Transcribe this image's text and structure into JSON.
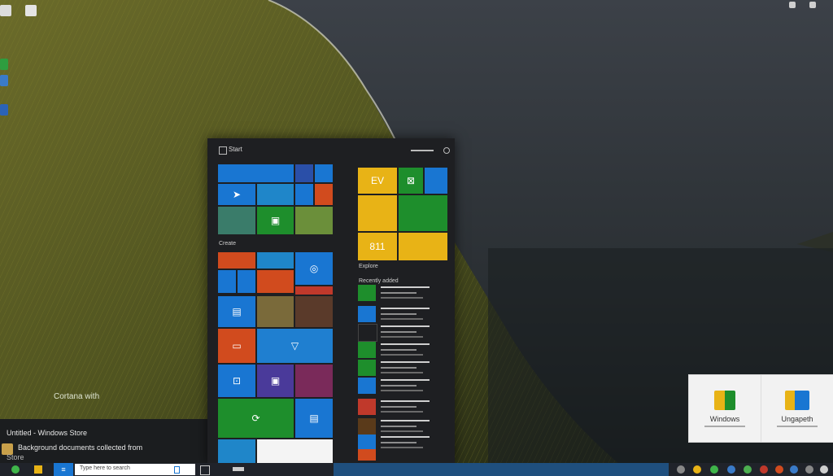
{
  "desktop": {
    "left_label": "Cortana with",
    "window_title": "Untitled - Windows Store",
    "window_line1": "Background documents collected from",
    "window_line2": "Store"
  },
  "start_menu": {
    "title": "Start",
    "header_left": "Create",
    "header_mid": "Explore",
    "section_label": "Recently added"
  },
  "taskbar": {
    "search_placeholder": "Type here to search"
  },
  "notification": {
    "item1": "Windows",
    "item2": "Ungapeth"
  },
  "colors": {
    "blue": "#1976d2",
    "green": "#1e8e2c",
    "orange": "#d14b1e",
    "yellow": "#e8b316",
    "darkblue": "#2a4fa8",
    "purple": "#4a3a9a"
  }
}
